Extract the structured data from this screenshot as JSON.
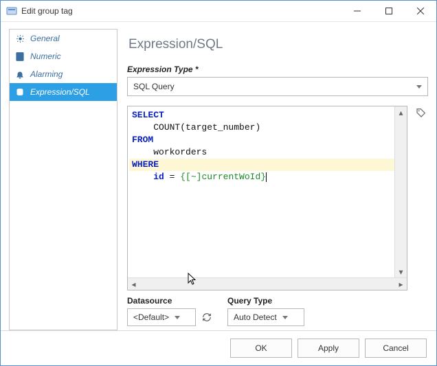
{
  "window": {
    "title": "Edit group tag"
  },
  "sidebar": {
    "items": [
      {
        "label": "General",
        "icon": "gear-icon"
      },
      {
        "label": "Numeric",
        "icon": "calculator-icon"
      },
      {
        "label": "Alarming",
        "icon": "bell-icon"
      },
      {
        "label": "Expression/SQL",
        "icon": "database-icon"
      }
    ],
    "selected_index": 3
  },
  "panel": {
    "title": "Expression/SQL",
    "expression_type_label": "Expression Type *",
    "expression_type_value": "SQL Query",
    "sql": {
      "line1_kw": "SELECT",
      "line2": "COUNT(target_number)",
      "line3_kw": "FROM",
      "line4": "workorders",
      "line5_kw": "WHERE",
      "line6_kw": "id",
      "line6_eq": " = ",
      "line6_param": "{[~]currentWoId}"
    },
    "datasource_label": "Datasource",
    "datasource_value": "<Default>",
    "query_type_label": "Query Type",
    "query_type_value": "Auto Detect"
  },
  "footer": {
    "ok": "OK",
    "apply": "Apply",
    "cancel": "Cancel"
  }
}
